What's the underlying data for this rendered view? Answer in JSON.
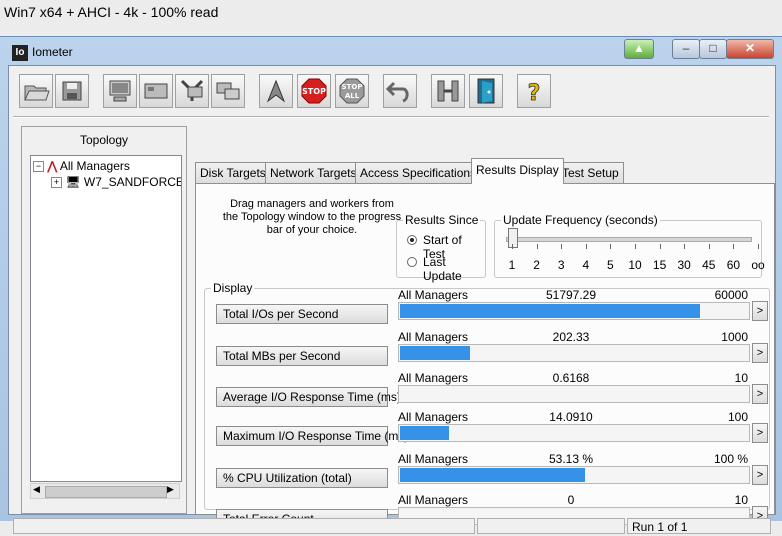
{
  "outer_title": "Win7 x64 + AHCI - 4k - 100% read",
  "window": {
    "title": "Iometer",
    "app_icon_text": "Io"
  },
  "toolbar": {
    "buttons": [
      {
        "name": "open-icon"
      },
      {
        "name": "save-icon"
      },
      {
        "name": "display-icon"
      },
      {
        "name": "disk-icon"
      },
      {
        "name": "worker-icon"
      },
      {
        "name": "network-icon"
      },
      {
        "name": "start-icon"
      },
      {
        "name": "stop-icon",
        "label": "STOP"
      },
      {
        "name": "stop-all-icon",
        "label": "STOP ALL"
      },
      {
        "name": "reset-icon"
      },
      {
        "name": "exit-icon"
      },
      {
        "name": "door-icon"
      },
      {
        "name": "help-icon",
        "label": "?"
      }
    ]
  },
  "topology": {
    "title": "Topology",
    "root": "All Managers",
    "child": "W7_SANDFORCE"
  },
  "tabs": [
    {
      "label": "Disk Targets"
    },
    {
      "label": "Network Targets"
    },
    {
      "label": "Access Specifications"
    },
    {
      "label": "Results Display",
      "active": true
    },
    {
      "label": "Test Setup"
    }
  ],
  "results": {
    "drag_text": "Drag managers and workers from the Topology window to the progress bar of your choice.",
    "results_since": {
      "title": "Results Since",
      "options": [
        "Start of Test",
        "Last Update"
      ],
      "selected": 0
    },
    "update_frequency": {
      "title": "Update Frequency (seconds)",
      "ticks": [
        "1",
        "2",
        "3",
        "4",
        "5",
        "10",
        "15",
        "30",
        "45",
        "60",
        "oo"
      ],
      "selected": "1"
    },
    "display_title": "Display",
    "metrics": [
      {
        "label": "Total I/Os per Second",
        "manager": "All Managers",
        "value": "51797.29",
        "max": "60000",
        "fraction": 0.8633
      },
      {
        "label": "Total MBs per Second",
        "manager": "All Managers",
        "value": "202.33",
        "max": "1000",
        "fraction": 0.2023
      },
      {
        "label": "Average I/O Response Time (ms)",
        "manager": "All Managers",
        "value": "0.6168",
        "max": "10",
        "fraction": 0.0
      },
      {
        "label": "Maximum I/O Response Time (ms)",
        "manager": "All Managers",
        "value": "14.0910",
        "max": "100",
        "fraction": 0.1409
      },
      {
        "label": "% CPU Utilization (total)",
        "manager": "All Managers",
        "value": "53.13 %",
        "max": "100 %",
        "fraction": 0.5313
      },
      {
        "label": "Total Error Count",
        "manager": "All Managers",
        "value": "0",
        "max": "10",
        "fraction": 0.0
      }
    ]
  },
  "statusbar": {
    "run_text": "Run 1 of 1"
  },
  "colors": {
    "bar_fill": "#3592e8",
    "stop_red": "#d62020"
  }
}
